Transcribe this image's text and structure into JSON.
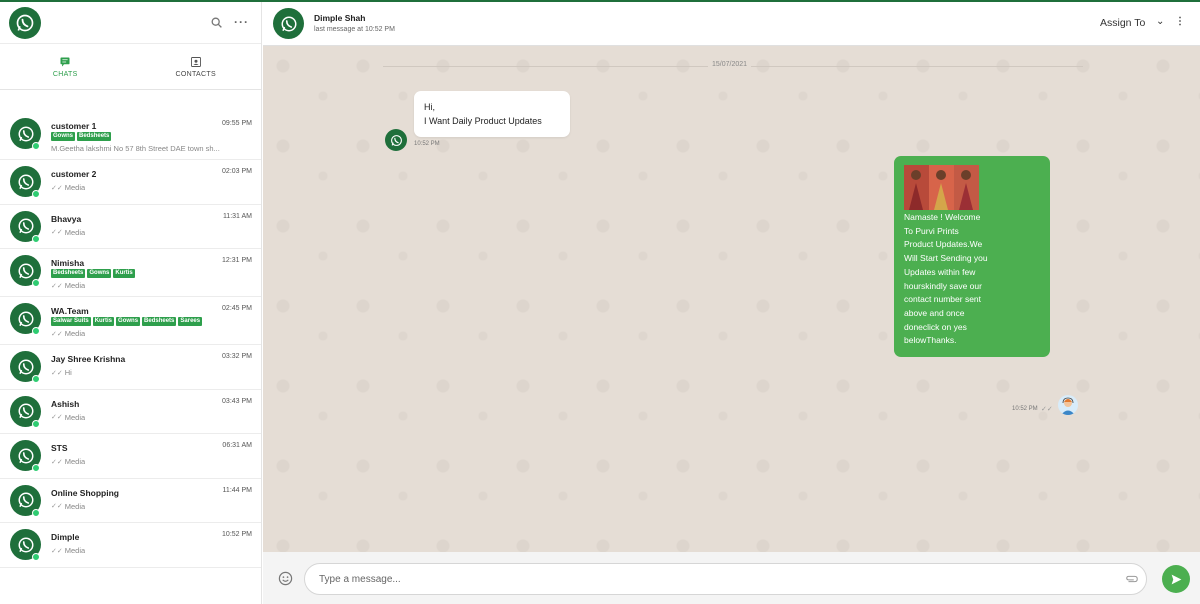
{
  "sidebar": {
    "tabs": [
      {
        "label": "CHATS",
        "icon": "chat-icon",
        "active": true
      },
      {
        "label": "CONTACTS",
        "icon": "contacts-icon",
        "active": false
      }
    ],
    "chats": [
      {
        "name": "customer 1",
        "time": "09:55 PM",
        "tags": [
          "Gowns",
          "Bedsheets"
        ],
        "preview": "M.Geetha lakshmi No 57 8th Street DAE town sh...",
        "ticks": ""
      },
      {
        "name": "customer 2",
        "time": "02:03 PM",
        "tags": [],
        "preview": "Media",
        "ticks": "✓✓"
      },
      {
        "name": "Bhavya",
        "time": "11:31 AM",
        "tags": [],
        "preview": "Media",
        "ticks": "✓✓"
      },
      {
        "name": "Nimisha",
        "time": "12:31 PM",
        "tags": [
          "Bedsheets",
          "Gowns",
          "Kurtis"
        ],
        "preview": "Media",
        "ticks": "✓✓"
      },
      {
        "name": "WA.Team",
        "time": "02:45 PM",
        "tags": [
          "Salwar Suits",
          "Kurtis",
          "Gowns",
          "Bedsheets",
          "Sarees"
        ],
        "preview": "Media",
        "ticks": "✓✓"
      },
      {
        "name": "Jay Shree Krishna",
        "time": "03:32 PM",
        "tags": [],
        "preview": "Hi",
        "ticks": "✓✓"
      },
      {
        "name": "Ashish",
        "time": "03:43 PM",
        "tags": [],
        "preview": "Media",
        "ticks": "✓✓"
      },
      {
        "name": "STS",
        "time": "06:31 AM",
        "tags": [],
        "preview": "Media",
        "ticks": "✓✓"
      },
      {
        "name": "Online Shopping",
        "time": "11:44 PM",
        "tags": [],
        "preview": "Media",
        "ticks": "✓✓"
      },
      {
        "name": "Dimple",
        "time": "10:52 PM",
        "tags": [],
        "preview": "Media",
        "ticks": "✓✓"
      }
    ]
  },
  "header": {
    "contact_name": "Dimple Shah",
    "last_message": "last message at 10:52 PM",
    "assign_label": "Assign To"
  },
  "conversation": {
    "date": "15/07/2021",
    "incoming": {
      "lines": [
        "Hi,",
        "I Want Daily Product Updates"
      ],
      "time": "10:52 PM"
    },
    "outgoing": {
      "text": "Namaste ! Welcome To Purvi Prints Product Updates.We Will Start Sending you Updates within few hourskindly save our contact number sent above and once doneclick on yes belowThanks.",
      "time": "10:52 PM",
      "ticks": "✓✓"
    }
  },
  "composer": {
    "placeholder": "Type a message..."
  },
  "colors": {
    "brand": "#1f6f3b",
    "accent": "#4caf50",
    "tag": "#2e9f4c",
    "chat_bg": "#e5ddd5"
  }
}
